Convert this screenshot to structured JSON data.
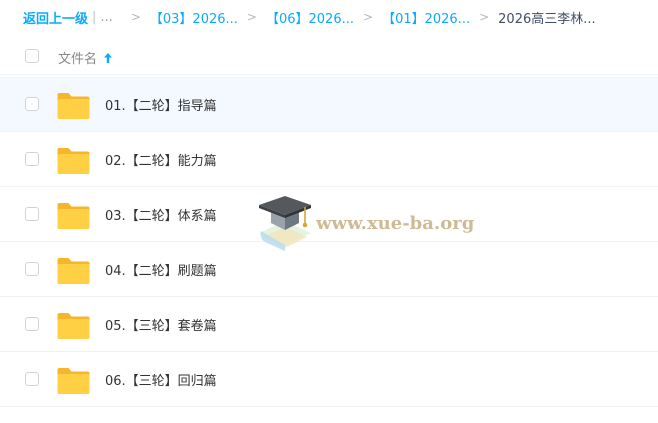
{
  "breadcrumb": {
    "back_label": "返回上一级",
    "pipe": "|",
    "ellipsis": "...",
    "separator": ">",
    "items": [
      "【03】2026...",
      "【06】2026...",
      "【01】2026..."
    ],
    "current": "2026高三李林..."
  },
  "header": {
    "column_name": "文件名"
  },
  "files": [
    {
      "name": "01.【二轮】指导篇"
    },
    {
      "name": "02.【二轮】能力篇"
    },
    {
      "name": "03.【二轮】体系篇"
    },
    {
      "name": "04.【二轮】刷题篇"
    },
    {
      "name": "05.【三轮】套卷篇"
    },
    {
      "name": "06.【三轮】回归篇"
    }
  ],
  "watermark": {
    "text": "www.xue-ba.org"
  },
  "colors": {
    "accent": "#09aaff",
    "folder": "#ffcf44",
    "hover_row": "#f4f9ff"
  }
}
